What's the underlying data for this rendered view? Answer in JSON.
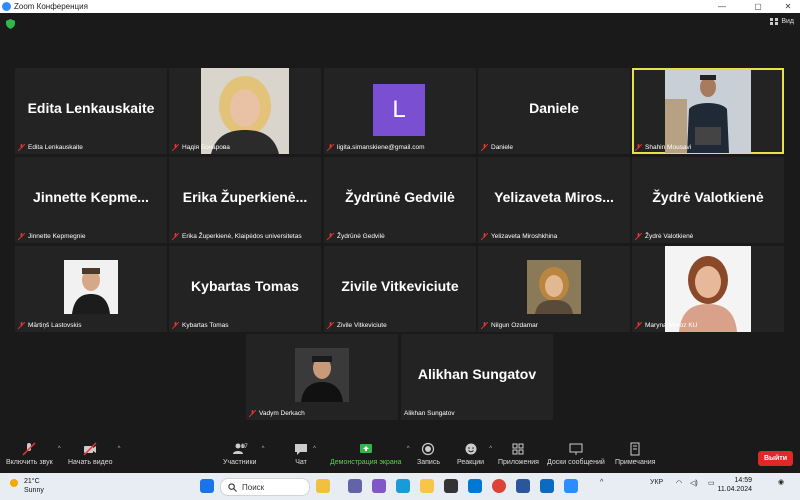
{
  "window": {
    "title": "Zoom Конференция"
  },
  "topbar": {
    "view_label": "Вид"
  },
  "participants": [
    {
      "name": "Edita Lenkauskaite",
      "display": "Edita Lenkauskaite",
      "type": "name"
    },
    {
      "name": "Надія Бочарова",
      "type": "photo"
    },
    {
      "name": "ligita.simanskiene@gmail.com",
      "display": "L",
      "type": "avatar",
      "color": "#7b4fd1"
    },
    {
      "name": "Daniele",
      "display": "Daniele",
      "type": "name"
    },
    {
      "name": "Shahin Mousavi",
      "type": "photo",
      "active": true
    },
    {
      "name": "Jinnette Kepmegnie",
      "display": "Jinnette  Kepme...",
      "type": "name"
    },
    {
      "name": "Erika Župerkienė, Klaipėdos universitetas",
      "display": "Erika  Župerkienė...",
      "type": "name"
    },
    {
      "name": "Žydrūnė Gedvilė",
      "display": "Žydrūnė Gedvilė",
      "type": "name"
    },
    {
      "name": "Yelizaveta Miroshkhina",
      "display": "Yelizaveta  Miros...",
      "type": "name"
    },
    {
      "name": "Žydrė Valotkienė",
      "display": "Žydrė Valotkienė",
      "type": "name"
    },
    {
      "name": "Mārtiņš Lastovskis",
      "type": "photo"
    },
    {
      "name": "Kybartas Tomas",
      "display": "Kybartas Tomas",
      "type": "name"
    },
    {
      "name": "Zivile Vitkeviciute",
      "display": "Zivile Vitkeviciute",
      "type": "name"
    },
    {
      "name": "Nilgun Ozdamar",
      "type": "photo"
    },
    {
      "name": "Maryna Moroz KU",
      "type": "photo"
    },
    {
      "name": "Vadym Derkach",
      "type": "photo"
    },
    {
      "name": "Alikhan Sungatov",
      "display": "Alikhan Sungatov",
      "type": "name"
    }
  ],
  "toolbar": {
    "unmute": "Включить звук",
    "start_video": "Начать видео",
    "participants": "Участники",
    "participants_count": "17",
    "chat": "Чат",
    "share": "Демонстрация экрана",
    "record": "Запись",
    "reactions": "Реакции",
    "apps": "Приложения",
    "whiteboards": "Доски сообщений",
    "notes": "Примечания",
    "leave": "Выйти"
  },
  "taskbar": {
    "temp": "21°C",
    "weather": "Sunny",
    "search": "Поиск",
    "lang": "УКР",
    "time": "14:59",
    "date": "11.04.2024"
  },
  "colors": {
    "active_speaker": "#e6e34a",
    "leave": "#e02828",
    "share": "#5dd14a"
  }
}
